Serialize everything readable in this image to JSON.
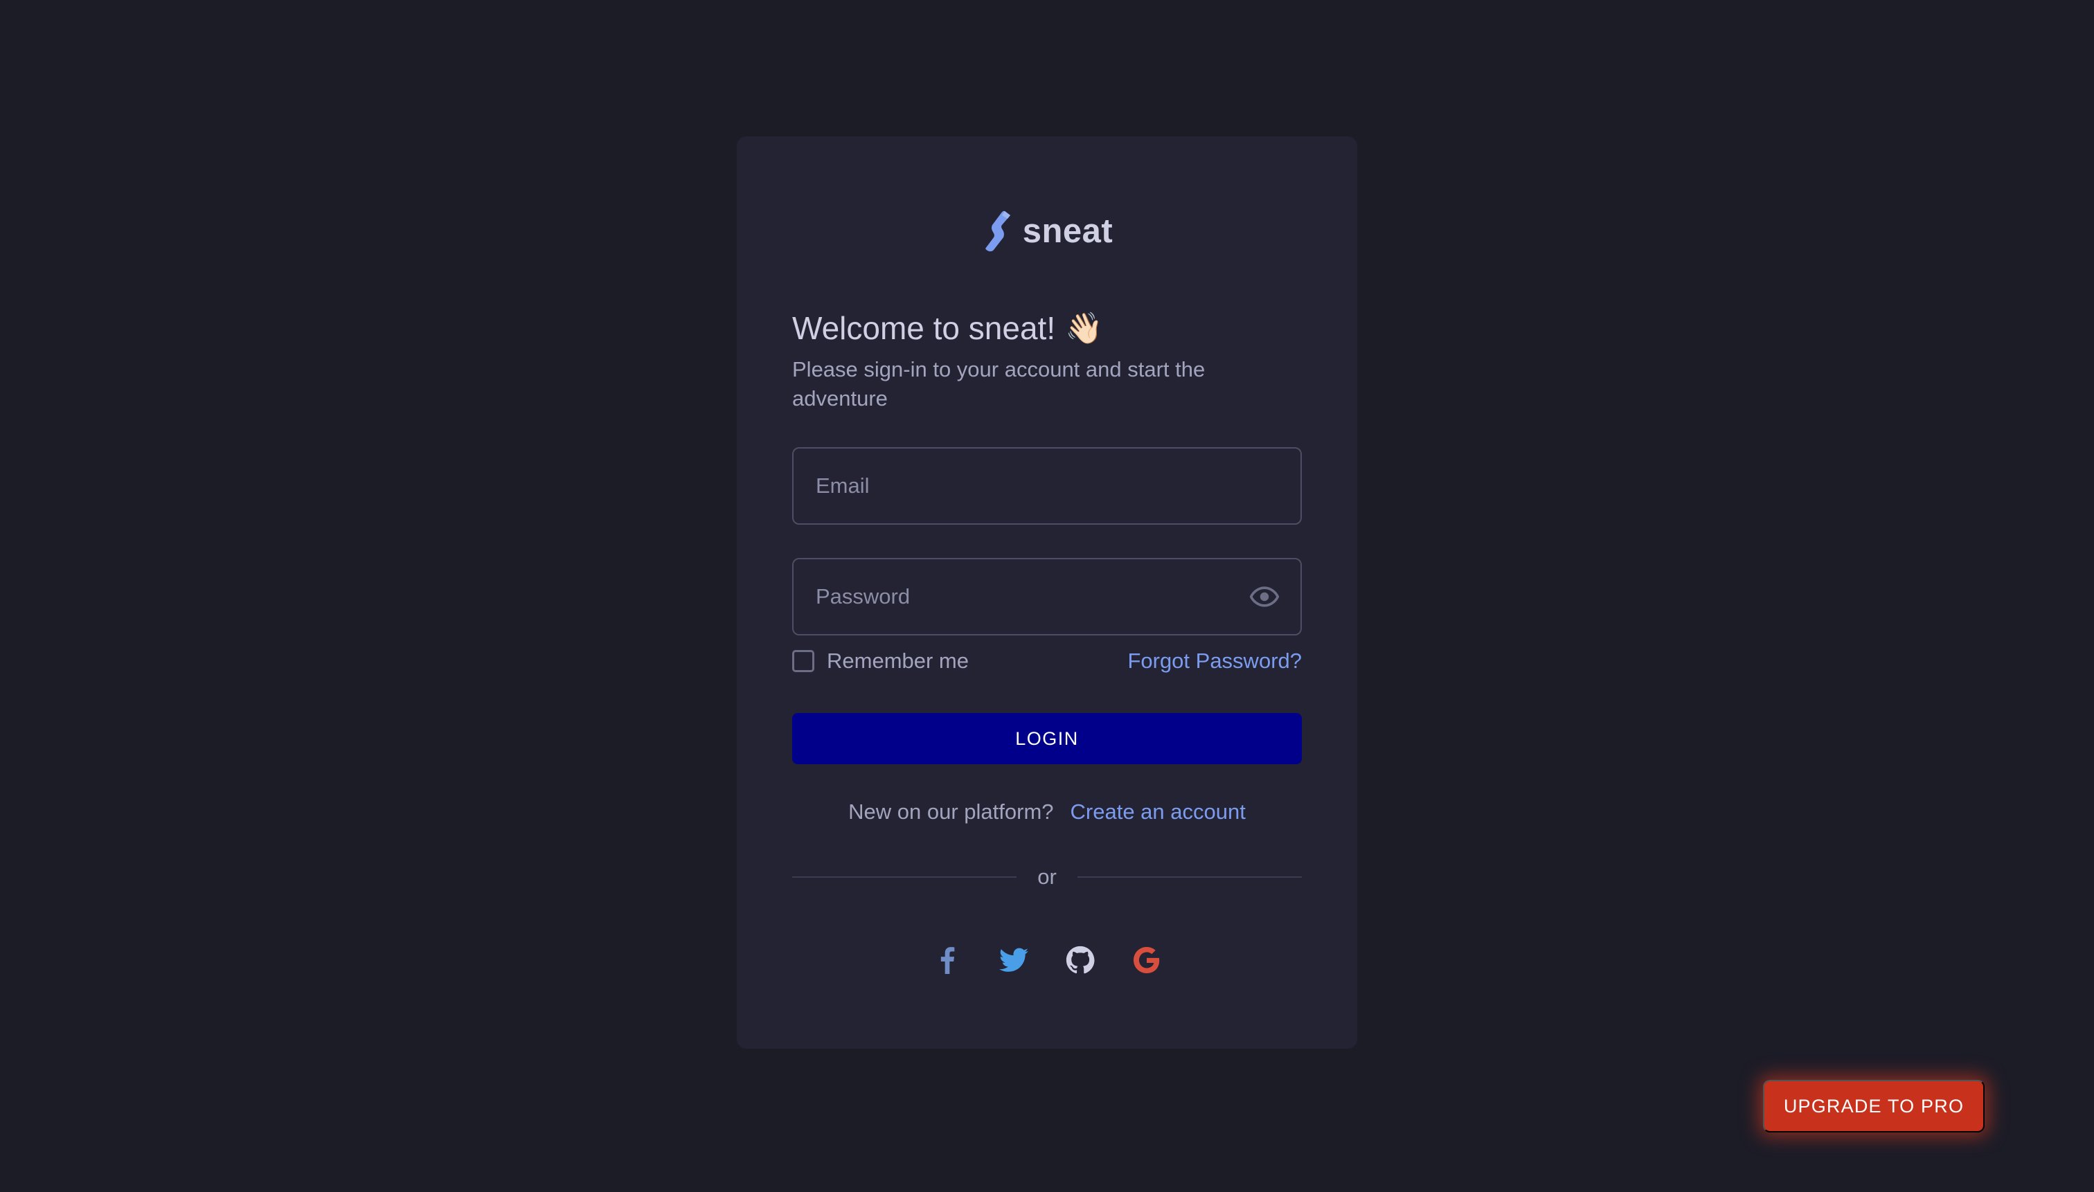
{
  "brand": {
    "name": "sneat",
    "logo_color": "#7c9cf0"
  },
  "welcome": {
    "title": "Welcome to sneat!",
    "emoji": "👋🏻",
    "subtitle": "Please sign-in to your account and start the adventure"
  },
  "form": {
    "email_placeholder": "Email",
    "email_value": "",
    "password_placeholder": "Password",
    "password_value": "",
    "remember_label": "Remember me",
    "remember_checked": false,
    "forgot_label": "Forgot Password?",
    "login_label": "LOGIN"
  },
  "signup": {
    "text": "New on our platform?",
    "link": "Create an account"
  },
  "divider": {
    "text": "or"
  },
  "social": [
    {
      "icon": "facebook-icon",
      "color": "#6f8dc6"
    },
    {
      "icon": "twitter-icon",
      "color": "#4a9ee8"
    },
    {
      "icon": "github-icon",
      "color": "#cfd0e4"
    },
    {
      "icon": "google-icon",
      "color": "#d94f3d"
    }
  ],
  "upgrade": {
    "label": "UPGRADE TO PRO"
  },
  "colors": {
    "background": "#1c1c27",
    "card": "#232333",
    "primary_button": "#00008b",
    "link": "#7c9cf0",
    "upgrade_button": "#c8321d"
  }
}
